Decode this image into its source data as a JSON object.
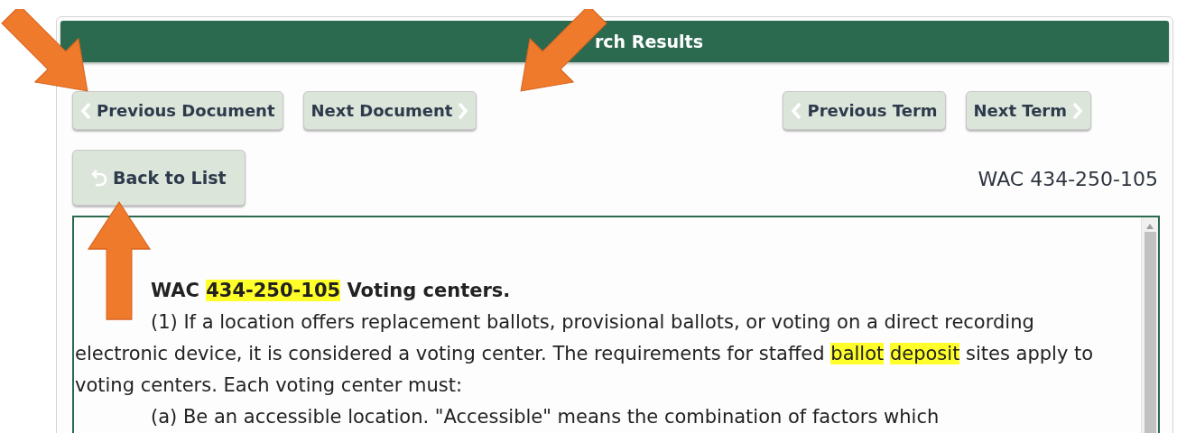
{
  "panel": {
    "title": "rch Results"
  },
  "nav_buttons": [
    {
      "label": "Previous Document",
      "kind": "prev"
    },
    {
      "label": "Next Document",
      "kind": "next"
    },
    {
      "label": "Previous Term",
      "kind": "prev"
    },
    {
      "label": "Next Term",
      "kind": "next"
    }
  ],
  "back_button": {
    "label": "Back to List"
  },
  "citation": "WAC 434-250-105",
  "document": {
    "paragraphs": [
      {
        "kind": "heading",
        "segments": [
          {
            "text": "WAC ",
            "highlight": false
          },
          {
            "text": "434-250-105",
            "highlight": true
          },
          {
            "text": " Voting centers.",
            "highlight": false
          }
        ]
      },
      {
        "kind": "body",
        "segments": [
          {
            "text": "(1) If a location offers replacement ballots, provisional ballots, or voting on a direct recording electronic device, it is considered a voting center. The requirements for staffed ",
            "highlight": false
          },
          {
            "text": "ballot",
            "highlight": true
          },
          {
            "text": "deposit",
            "highlight": true
          },
          {
            "text": " sites apply to voting centers. Each voting center must:",
            "highlight": false
          }
        ]
      },
      {
        "kind": "body",
        "segments": [
          {
            "text": "(a) Be an accessible location. \"Accessible\" means the combination of factors which",
            "highlight": false
          }
        ]
      }
    ]
  }
}
